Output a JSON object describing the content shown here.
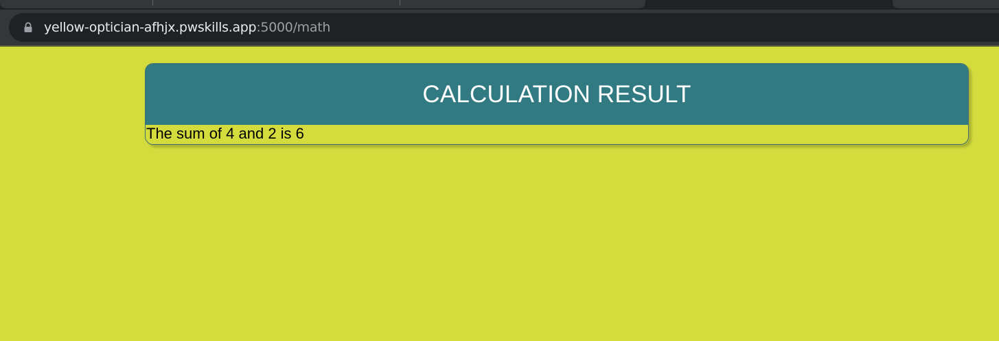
{
  "browser": {
    "url_host": "yellow-optician-afhjx.pwskills.app",
    "url_rest": ":5000/math",
    "lock_icon": "lock-icon"
  },
  "card": {
    "title": "CALCULATION RESULT",
    "result_text": "The sum of 4 and 2 is 6"
  },
  "colors": {
    "page_background": "#d4db3d",
    "header_background": "#317a82",
    "header_text": "#ffffff"
  }
}
